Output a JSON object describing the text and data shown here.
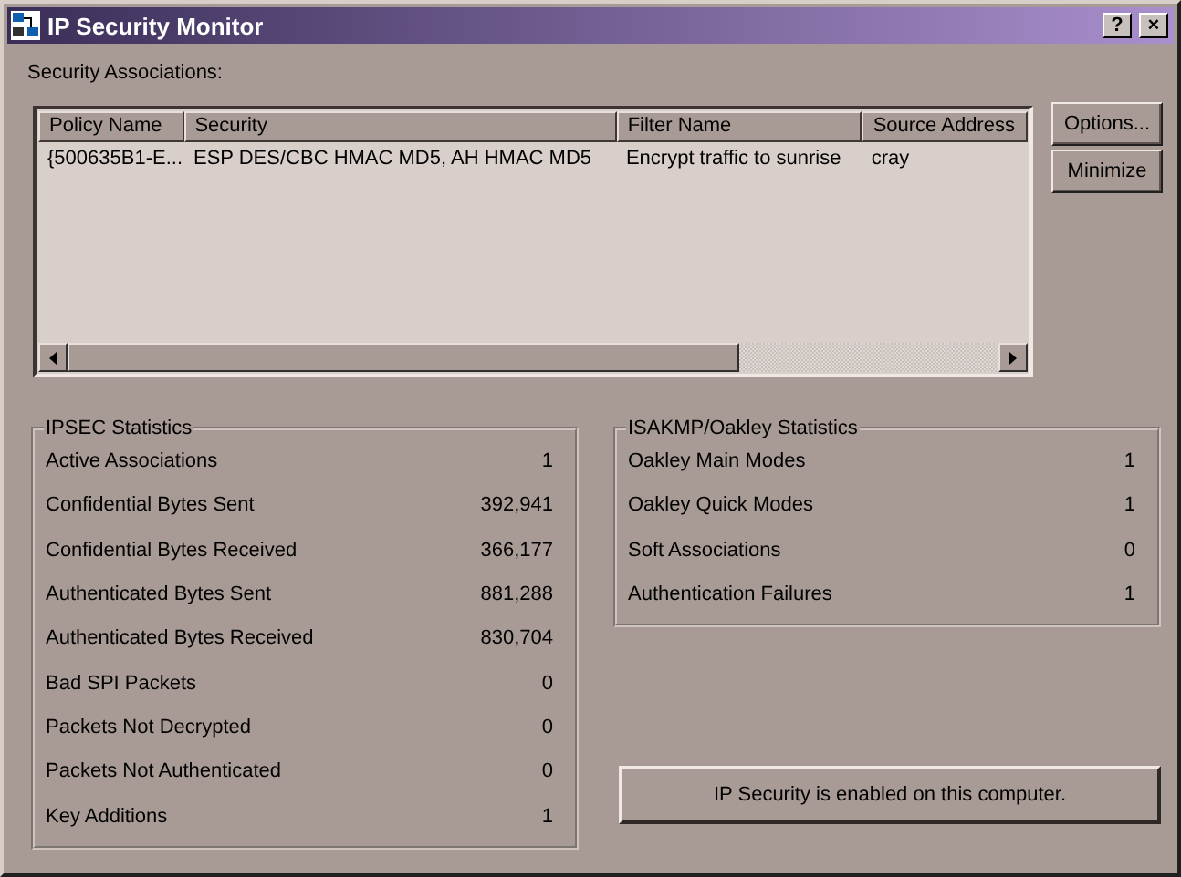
{
  "window": {
    "title": "IP Security Monitor",
    "help_button": "?",
    "close_button": "×"
  },
  "associations_label": "Security Associations:",
  "table": {
    "columns": [
      "Policy Name",
      "Security",
      "Filter Name",
      "Source Address"
    ],
    "rows": [
      [
        "{500635B1-E...",
        "ESP DES/CBC HMAC MD5, AH HMAC MD5",
        "Encrypt traffic to sunrise",
        "cray"
      ]
    ]
  },
  "buttons": [
    "Options...",
    "Minimize"
  ],
  "ipsec": {
    "title": "IPSEC Statistics",
    "rows": [
      {
        "label": "Active Associations",
        "value": "1"
      },
      {
        "label": "Confidential Bytes Sent",
        "value": "392,941"
      },
      {
        "label": "Confidential Bytes Received",
        "value": "366,177"
      },
      {
        "label": "Authenticated Bytes Sent",
        "value": "881,288"
      },
      {
        "label": "Authenticated Bytes Received",
        "value": "830,704"
      },
      {
        "label": "Bad SPI Packets",
        "value": "0"
      },
      {
        "label": "Packets Not Decrypted",
        "value": "0"
      },
      {
        "label": "Packets Not Authenticated",
        "value": "0"
      },
      {
        "label": "Key Additions",
        "value": "1"
      }
    ]
  },
  "isakmp": {
    "title": "ISAKMP/Oakley Statistics",
    "rows": [
      {
        "label": "Oakley Main Modes",
        "value": "1"
      },
      {
        "label": "Oakley Quick Modes",
        "value": "1"
      },
      {
        "label": "Soft Associations",
        "value": "0"
      },
      {
        "label": "Authentication Failures",
        "value": "1"
      }
    ]
  },
  "status": "IP Security is enabled on this computer."
}
